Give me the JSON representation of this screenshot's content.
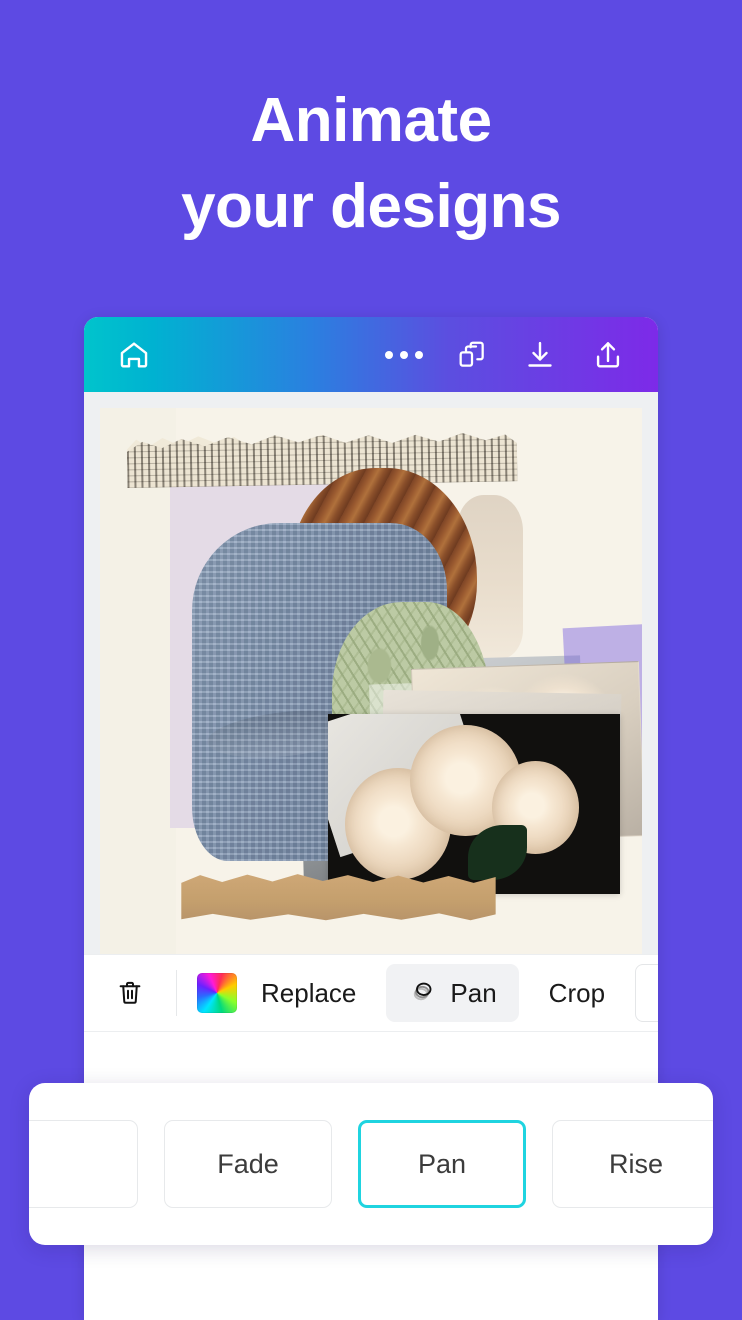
{
  "theme": {
    "background": "#5d4ae3",
    "appbar_gradient_start": "#00c4cc",
    "appbar_gradient_end": "#7d2ae8",
    "accent_selected": "#1fd4e0"
  },
  "headline": {
    "line1": "Animate",
    "line2": "your designs"
  },
  "appbar": {
    "icons": [
      {
        "name": "home-icon",
        "label": "Home"
      },
      {
        "name": "more-icon",
        "label": "More options"
      },
      {
        "name": "duplicate-icon",
        "label": "Duplicate page"
      },
      {
        "name": "download-icon",
        "label": "Download"
      },
      {
        "name": "share-icon",
        "label": "Share"
      }
    ]
  },
  "canvas": {
    "description": "Collage design with torn newspaper strip, person in blue knit sweater holding greenery, white rose photos and kraft paper strip"
  },
  "edit_toolbar": {
    "delete_label": "Delete",
    "color_swatch_label": "Color",
    "items": [
      {
        "name": "replace-button",
        "label": "Replace",
        "selected": false
      },
      {
        "name": "pan-button",
        "label": "Pan",
        "selected": true
      },
      {
        "name": "crop-button",
        "label": "Crop",
        "selected": false
      }
    ],
    "next_label": "›"
  },
  "animation_panel": {
    "options": [
      {
        "label": "",
        "selected": false
      },
      {
        "label": "Fade",
        "selected": false
      },
      {
        "label": "Pan",
        "selected": true
      },
      {
        "label": "Rise",
        "selected": false
      },
      {
        "label": "",
        "selected": false
      }
    ]
  }
}
